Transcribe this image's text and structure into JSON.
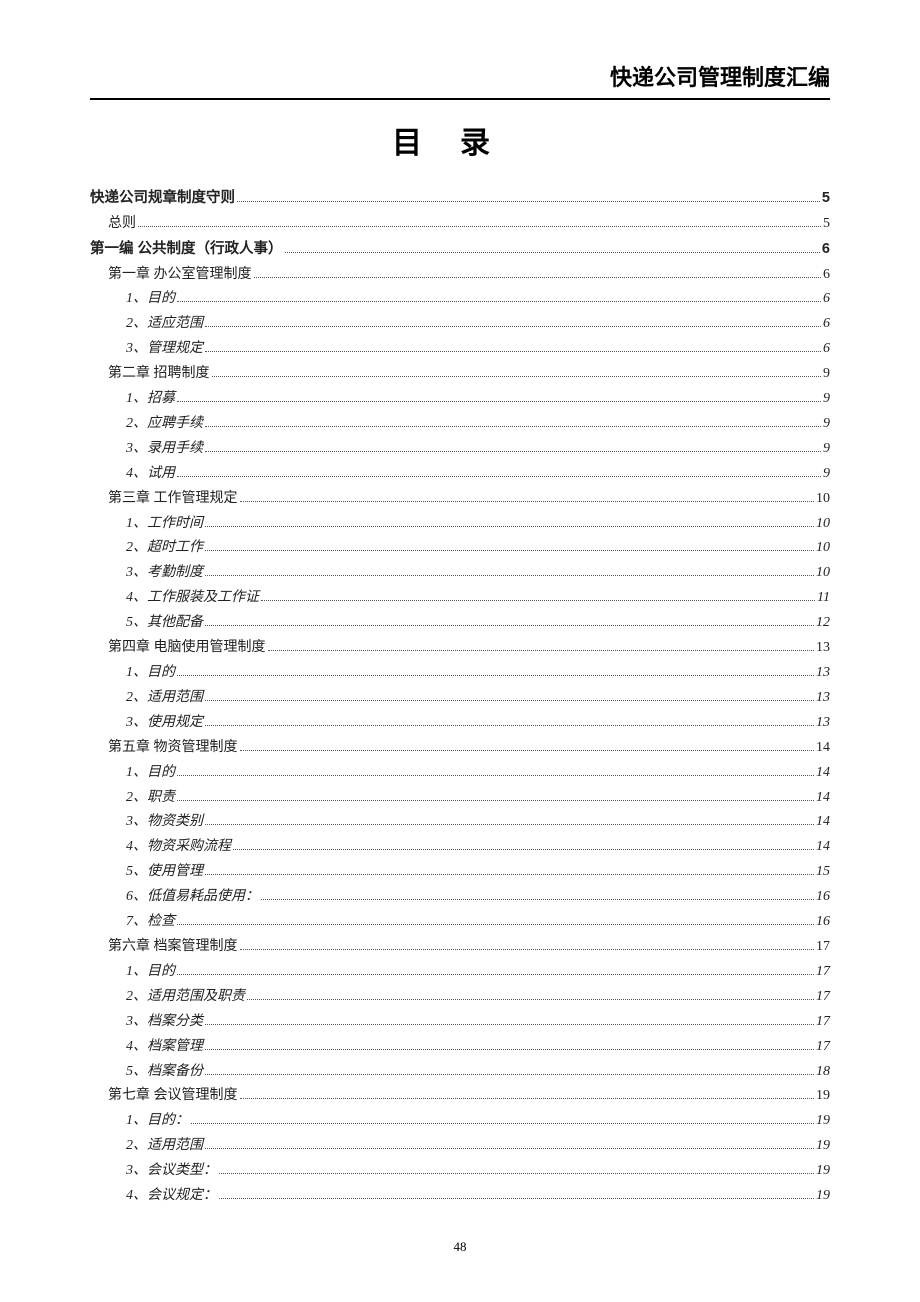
{
  "header_title": "快递公司管理制度汇编",
  "main_title": "目录",
  "page_number": "48",
  "toc": [
    {
      "level": 0,
      "title": "快递公司规章制度守则",
      "page": "5"
    },
    {
      "level": 1,
      "title": "总则",
      "page": "5"
    },
    {
      "level": 0,
      "title": "第一编 公共制度（行政人事）",
      "page": "6"
    },
    {
      "level": 1,
      "title": "第一章 办公室管理制度",
      "page": "6"
    },
    {
      "level": 2,
      "title": "1、目的",
      "page": "6"
    },
    {
      "level": 2,
      "title": "2、适应范围",
      "page": "6"
    },
    {
      "level": 2,
      "title": "3、管理规定",
      "page": "6"
    },
    {
      "level": 1,
      "title": "第二章 招聘制度",
      "page": "9"
    },
    {
      "level": 2,
      "title": "1、招募",
      "page": "9"
    },
    {
      "level": 2,
      "title": "2、应聘手续",
      "page": "9"
    },
    {
      "level": 2,
      "title": "3、录用手续",
      "page": "9"
    },
    {
      "level": 2,
      "title": "4、试用",
      "page": "9"
    },
    {
      "level": 1,
      "title": "第三章 工作管理规定",
      "page": "10"
    },
    {
      "level": 2,
      "title": "1、工作时间",
      "page": "10"
    },
    {
      "level": 2,
      "title": "2、超时工作",
      "page": "10"
    },
    {
      "level": 2,
      "title": "3、考勤制度",
      "page": "10"
    },
    {
      "level": 2,
      "title": "4、工作服装及工作证",
      "page": "11"
    },
    {
      "level": 2,
      "title": "5、其他配备",
      "page": "12"
    },
    {
      "level": 1,
      "title": "第四章 电脑使用管理制度",
      "page": "13"
    },
    {
      "level": 2,
      "title": "1、目的",
      "page": "13"
    },
    {
      "level": 2,
      "title": "2、适用范围",
      "page": "13"
    },
    {
      "level": 2,
      "title": "3、使用规定",
      "page": "13"
    },
    {
      "level": 1,
      "title": "第五章 物资管理制度",
      "page": "14"
    },
    {
      "level": 2,
      "title": "1、目的",
      "page": "14"
    },
    {
      "level": 2,
      "title": "2、职责",
      "page": "14"
    },
    {
      "level": 2,
      "title": "3、物资类别",
      "page": "14"
    },
    {
      "level": 2,
      "title": "4、物资采购流程",
      "page": "14"
    },
    {
      "level": 2,
      "title": "5、使用管理",
      "page": "15"
    },
    {
      "level": 2,
      "title": "6、低值易耗品使用：",
      "page": "16"
    },
    {
      "level": 2,
      "title": "7、检查",
      "page": "16"
    },
    {
      "level": 1,
      "title": "第六章 档案管理制度",
      "page": "17"
    },
    {
      "level": 2,
      "title": "1、目的",
      "page": "17"
    },
    {
      "level": 2,
      "title": "2、适用范围及职责",
      "page": "17"
    },
    {
      "level": 2,
      "title": "3、档案分类",
      "page": "17"
    },
    {
      "level": 2,
      "title": "4、档案管理",
      "page": "17"
    },
    {
      "level": 2,
      "title": "5、档案备份",
      "page": "18"
    },
    {
      "level": 1,
      "title": "第七章 会议管理制度",
      "page": "19"
    },
    {
      "level": 2,
      "title": "1、目的：",
      "page": "19"
    },
    {
      "level": 2,
      "title": "2、适用范围",
      "page": "19"
    },
    {
      "level": 2,
      "title": "3、会议类型：",
      "page": "19"
    },
    {
      "level": 2,
      "title": "4、会议规定：",
      "page": "19"
    }
  ]
}
